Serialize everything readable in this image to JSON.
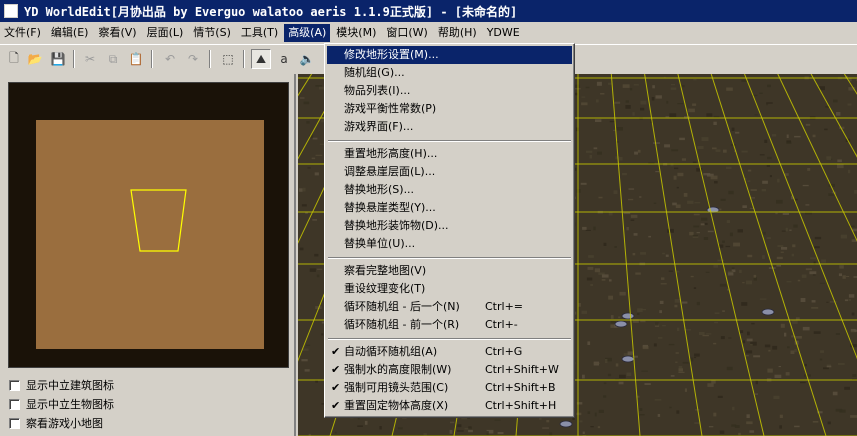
{
  "window": {
    "title": "YD WorldEdit[月协出品 by Everguo walatoo aeris 1.1.9正式版] - [未命名的]"
  },
  "menubar": [
    {
      "label": "文件(F)",
      "name": "menu-file"
    },
    {
      "label": "编辑(E)",
      "name": "menu-edit"
    },
    {
      "label": "察看(V)",
      "name": "menu-view"
    },
    {
      "label": "层面(L)",
      "name": "menu-layer"
    },
    {
      "label": "情节(S)",
      "name": "menu-scenario"
    },
    {
      "label": "工具(T)",
      "name": "menu-tools"
    },
    {
      "label": "高级(A)",
      "name": "menu-advanced"
    },
    {
      "label": "模块(M)",
      "name": "menu-module"
    },
    {
      "label": "窗口(W)",
      "name": "menu-window"
    },
    {
      "label": "帮助(H)",
      "name": "menu-help"
    },
    {
      "label": "YDWE",
      "name": "menu-ydwe"
    }
  ],
  "active_menu": "menu-advanced",
  "toolbar": [
    {
      "name": "new-icon",
      "glyph": "🗋"
    },
    {
      "name": "open-folder-icon",
      "glyph": "📂"
    },
    {
      "name": "save-icon",
      "glyph": "💾"
    },
    {
      "name": "cut-icon",
      "glyph": "✂"
    },
    {
      "name": "copy-icon",
      "glyph": "⧉"
    },
    {
      "name": "paste-icon",
      "glyph": "📋"
    },
    {
      "name": "undo-icon",
      "glyph": "↶"
    },
    {
      "name": "redo-icon",
      "glyph": "↷"
    },
    {
      "name": "select-icon",
      "glyph": "⬚"
    },
    {
      "name": "terrain-palette-icon",
      "glyph": "⛰"
    },
    {
      "name": "doodad-palette-icon",
      "glyph": "a"
    },
    {
      "name": "sound-icon",
      "glyph": "🔈"
    }
  ],
  "left_panel": {
    "checkboxes": [
      {
        "label": "显示中立建筑图标",
        "checked": false
      },
      {
        "label": "显示中立生物图标",
        "checked": false
      },
      {
        "label": "察看游戏小地图",
        "checked": false
      }
    ]
  },
  "dropdown": {
    "groups": [
      [
        {
          "label": "修改地形设置(M)...",
          "shortcut": "",
          "checked": false,
          "highlighted": true
        },
        {
          "label": "随机组(G)...",
          "shortcut": "",
          "checked": false
        },
        {
          "label": "物品列表(I)...",
          "shortcut": "",
          "checked": false
        },
        {
          "label": "游戏平衡性常数(P)",
          "shortcut": "",
          "checked": false
        },
        {
          "label": "游戏界面(F)...",
          "shortcut": "",
          "checked": false
        }
      ],
      [
        {
          "label": "重置地形高度(H)...",
          "shortcut": "",
          "checked": false
        },
        {
          "label": "调整悬崖层面(L)...",
          "shortcut": "",
          "checked": false
        },
        {
          "label": "替换地形(S)...",
          "shortcut": "",
          "checked": false
        },
        {
          "label": "替换悬崖类型(Y)...",
          "shortcut": "",
          "checked": false
        },
        {
          "label": "替换地形装饰物(D)...",
          "shortcut": "",
          "checked": false
        },
        {
          "label": "替换单位(U)...",
          "shortcut": "",
          "checked": false
        }
      ],
      [
        {
          "label": "察看完整地图(V)",
          "shortcut": "",
          "checked": false
        },
        {
          "label": "重设纹理变化(T)",
          "shortcut": "",
          "checked": false
        },
        {
          "label": "循环随机组 - 后一个(N)",
          "shortcut": "Ctrl+=",
          "checked": false
        },
        {
          "label": "循环随机组 - 前一个(R)",
          "shortcut": "Ctrl+-",
          "checked": false
        }
      ],
      [
        {
          "label": "自动循环随机组(A)",
          "shortcut": "Ctrl+G",
          "checked": true
        },
        {
          "label": "强制水的高度限制(W)",
          "shortcut": "Ctrl+Shift+W",
          "checked": true
        },
        {
          "label": "强制可用镜头范围(C)",
          "shortcut": "Ctrl+Shift+B",
          "checked": true
        },
        {
          "label": "重置固定物体高度(X)",
          "shortcut": "Ctrl+Shift+H",
          "checked": true
        }
      ]
    ]
  },
  "colors": {
    "titlebar": "#0a246a",
    "highlight": "#0a246a",
    "minimap_ground": "#9a6e3e",
    "camera_outline": "#ffff00",
    "grid": "#c8c800"
  }
}
